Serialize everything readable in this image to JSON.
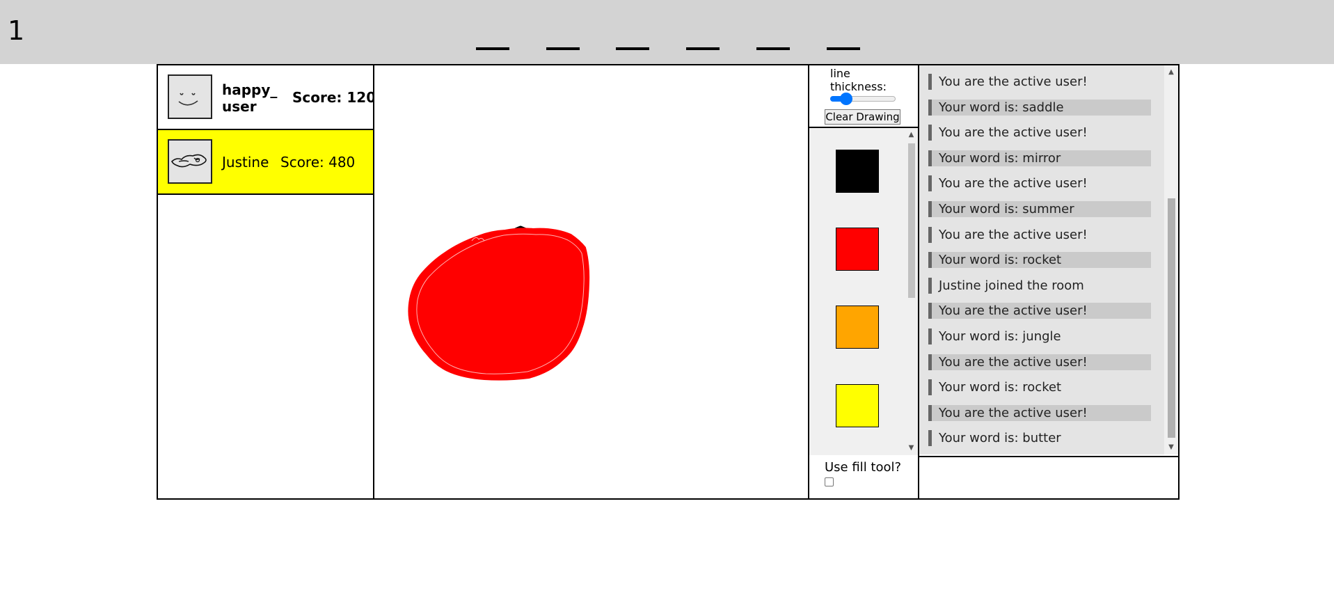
{
  "header": {
    "round": "1",
    "word_blanks": [
      "_",
      "_",
      "_",
      "_",
      "_",
      "_"
    ]
  },
  "players": [
    {
      "name": "happy_\nuser",
      "score": "Score: 120",
      "highlighted": false,
      "avatar_icon": "smiley-face-icon"
    },
    {
      "name": "Justine",
      "score": "Score: 480",
      "highlighted": true,
      "highlight_color": "#ffff00",
      "avatar_icon": "doodle-icon"
    }
  ],
  "tools": {
    "line_thickness_label": "line thickness:",
    "line_thickness_value": 0.18,
    "clear_button": "Clear Drawing",
    "colors": [
      "#000000",
      "#ff0000",
      "#ffa500",
      "#ffff00"
    ],
    "fill_tool_label": "Use fill tool?",
    "fill_tool_checked": false
  },
  "chat": {
    "messages": [
      "You are the active user!",
      "Your word is: saddle",
      "You are the active user!",
      "Your word is: mirror",
      "You are the active user!",
      "Your word is: summer",
      "You are the active user!",
      "Your word is: rocket",
      "Justine joined the room",
      "You are the active user!",
      "Your word is: jungle",
      "You are the active user!",
      "Your word is: rocket",
      "You are the active user!",
      "Your word is: butter"
    ],
    "input_value": ""
  },
  "colors": {
    "topbar": "#d3d3d3",
    "active_player": "#ffff00",
    "drawing_fill": "#ff0000",
    "drawing_stem": "#000000"
  }
}
